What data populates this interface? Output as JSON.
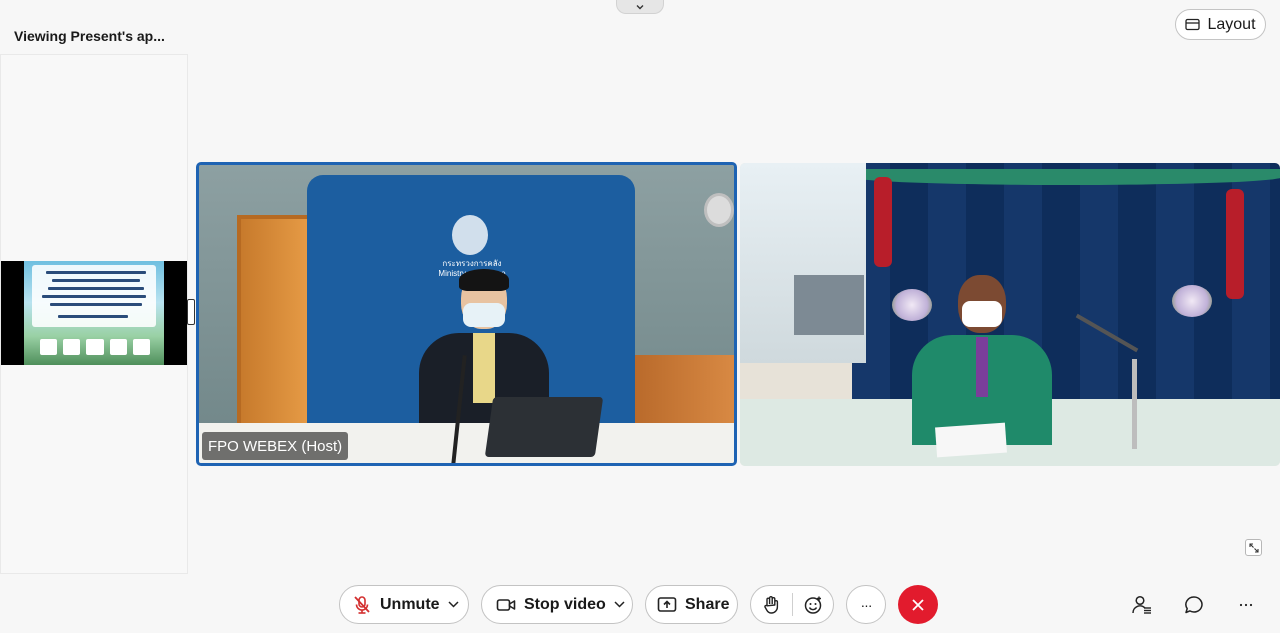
{
  "header": {
    "viewing_title": "Viewing Present's ap...",
    "layout_label": "Layout"
  },
  "participants": [
    {
      "name": "FPO WEBEX (Host)",
      "is_host": true,
      "active_speaker": true
    },
    {
      "name": "",
      "is_host": false,
      "active_speaker": false
    }
  ],
  "backdrop": {
    "org_name_th": "กระทรวงการคลัง",
    "org_name_en": "Ministry of Finance"
  },
  "controls": {
    "unmute_label": "Unmute",
    "stop_video_label": "Stop video",
    "share_label": "Share",
    "more_label": "···"
  },
  "icons": {
    "top_handle": "chevron-down-icon",
    "layout": "layout-icon",
    "mic_muted": "microphone-muted-icon",
    "video": "video-camera-icon",
    "share": "share-screen-icon",
    "raise_hand": "raise-hand-icon",
    "reactions": "emoji-reaction-icon",
    "end_call": "close-icon",
    "participants": "participants-icon",
    "chat": "chat-icon",
    "overflow": "more-options-icon",
    "expand": "expand-icon"
  },
  "colors": {
    "active_border": "#1e63b3",
    "end_call": "#e21b2d",
    "muted_mic": "#d32f2f"
  }
}
